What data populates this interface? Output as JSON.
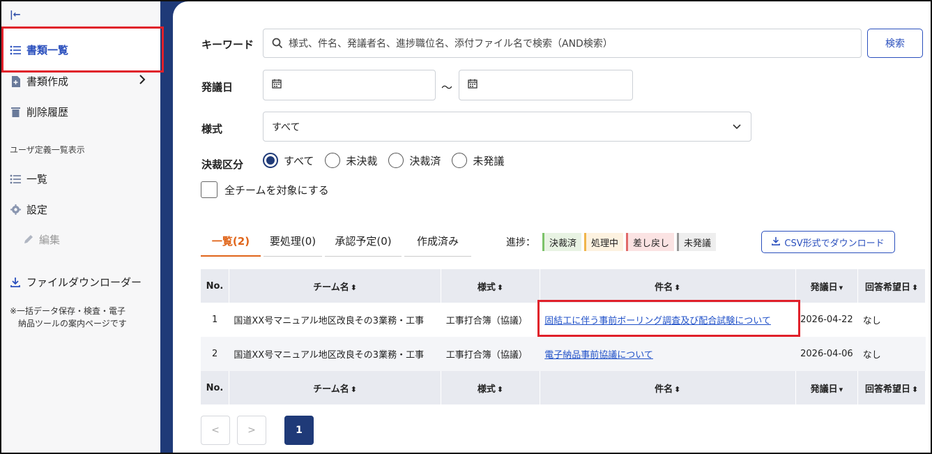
{
  "sidebar": {
    "collapse_label": "|←",
    "items": [
      {
        "label": "書類一覧",
        "icon": "list-icon"
      },
      {
        "label": "書類作成",
        "icon": "document-add-icon"
      },
      {
        "label": "削除履歴",
        "icon": "trash-icon"
      }
    ],
    "section_heading": "ユーザ定義一覧表示",
    "user_items": [
      {
        "label": "一覧",
        "icon": "list-icon"
      },
      {
        "label": "設定",
        "icon": "gear-icon"
      },
      {
        "label": "編集",
        "icon": "pencil-icon"
      }
    ],
    "downloader_label": "ファイルダウンローダー",
    "note_line1": "※一括データ保存・検査・電子",
    "note_line2": "納品ツールの案内ページです"
  },
  "search": {
    "keyword_label": "キーワード",
    "keyword_placeholder": "様式、件名、発議者名、進捗職位名、添付ファイル名で検索（AND検索）",
    "search_button": "検索",
    "date_label": "発議日",
    "date_separator": "～",
    "form_label": "様式",
    "form_value": "すべて",
    "decision_label": "決裁区分",
    "decision_options": [
      "すべて",
      "未決裁",
      "決裁済",
      "未発議"
    ],
    "decision_selected": 0,
    "all_teams_label": "全チームを対象にする"
  },
  "tabs": [
    {
      "label": "一覧(2)",
      "active": true
    },
    {
      "label": "要処理(0)",
      "active": false
    },
    {
      "label": "承認予定(0)",
      "active": false
    },
    {
      "label": "作成済み",
      "active": false
    }
  ],
  "progress_legend": {
    "label": "進捗：",
    "items": [
      {
        "label": "決裁済",
        "bg": "#e8f3e3",
        "border": "#7cc36a"
      },
      {
        "label": "処理中",
        "bg": "#fdf2e0",
        "border": "#f0b54a"
      },
      {
        "label": "差し戻し",
        "bg": "#fbe3e3",
        "border": "#e06a6a"
      },
      {
        "label": "未発議",
        "bg": "#eeeeee",
        "border": "#999999"
      }
    ]
  },
  "csv_button": "CSV形式でダウンロード",
  "table": {
    "headers": [
      "No.",
      "チーム名",
      "様式",
      "件名",
      "発議日",
      "回答希望日"
    ],
    "rows": [
      {
        "no": "1",
        "team": "国道XX号マニュアル地区改良その3業務・工事",
        "form": "工事打合簿（協議）",
        "subject": "固結工に伴う事前ボーリング調査及び配合試験について",
        "date": "2026-04-22",
        "answer": "なし"
      },
      {
        "no": "2",
        "team": "国道XX号マニュアル地区改良その3業務・工事",
        "form": "工事打合簿（協議）",
        "subject": "電子納品事前協議について",
        "date": "2026-04-06",
        "answer": "なし"
      }
    ]
  },
  "pagination": {
    "prev": "<",
    "next": ">",
    "current": "1"
  },
  "colors": {
    "accent": "#1f3a78",
    "tab_active": "#e0651a",
    "highlight": "#e0202a",
    "link": "#1f50c8"
  }
}
